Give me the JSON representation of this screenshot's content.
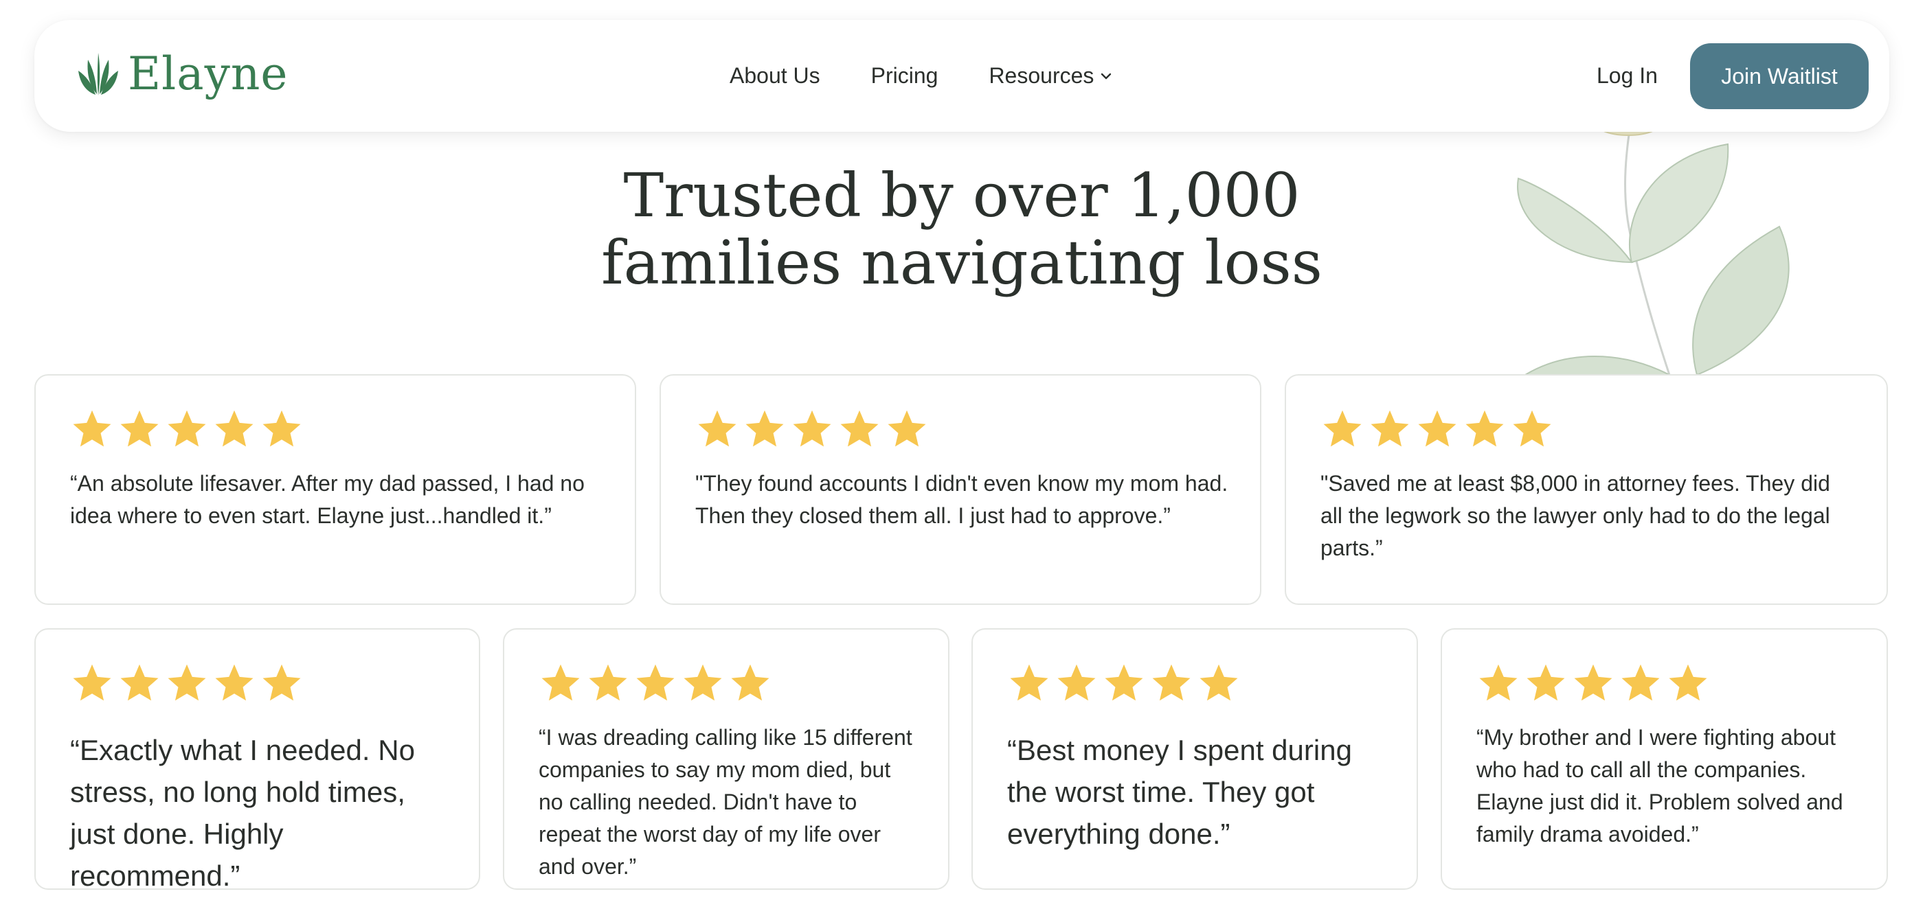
{
  "brand": {
    "name": "Elayne",
    "color": "#3a7d52",
    "icon": "leaf-logo-icon"
  },
  "nav": {
    "links": [
      {
        "label": "About Us"
      },
      {
        "label": "Pricing"
      },
      {
        "label": "Resources",
        "icon": "chevron-down-icon"
      }
    ],
    "login_label": "Log In",
    "cta_label": "Join Waitlist",
    "cta_color": "#4e7a8a"
  },
  "hero": {
    "title_line1": "Trusted by over 1,000",
    "title_line2": "families navigating loss"
  },
  "colors": {
    "star": "#f7c64f",
    "card_border": "#e4e6e3"
  },
  "reviews": [
    {
      "rating": 5,
      "text": "“An absolute lifesaver. After my dad passed, I had no idea where to even start. Elayne just...handled it.”"
    },
    {
      "rating": 5,
      "text": "\"They found accounts I didn't even know my mom had. Then they closed them all. I just had to approve.”"
    },
    {
      "rating": 5,
      "text": "\"Saved me at least $8,000 in attorney fees. They did all the legwork so the lawyer only had to do the legal parts.”"
    },
    {
      "rating": 5,
      "text": "“Exactly what I needed. No stress, no long hold times, just done. Highly recommend.”"
    },
    {
      "rating": 5,
      "text": "“I was dreading calling like 15 different companies to say my mom died, but no calling needed. Didn't have to repeat the worst day of my life over and over.”"
    },
    {
      "rating": 5,
      "text": "“Best money I spent during the worst time. They got everything done.”"
    },
    {
      "rating": 5,
      "text": "“My brother and I were fighting about who had to call all the companies. Elayne just did it. Problem solved and family drama avoided.”"
    }
  ]
}
